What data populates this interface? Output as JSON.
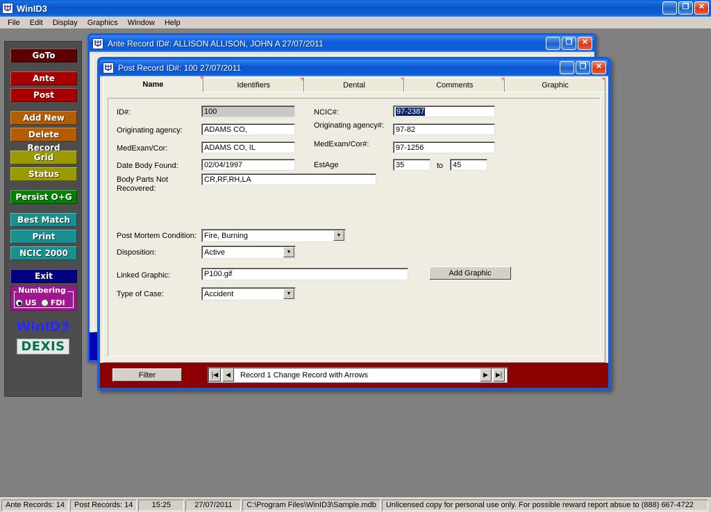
{
  "app": {
    "title": "WinID3",
    "icon": "winid-icon",
    "menus": [
      "File",
      "Edit",
      "Display",
      "Graphics",
      "Window",
      "Help"
    ],
    "window_controls": {
      "minimize": "_",
      "restore": "❐",
      "close": "✕"
    }
  },
  "sidebar": {
    "buttons": [
      {
        "label": "GoTo",
        "color": "#5c0000"
      },
      {
        "label": "Ante",
        "color": "#a80000"
      },
      {
        "label": "Post",
        "color": "#a80000"
      },
      {
        "label": "Add New",
        "color": "#b35c00"
      },
      {
        "label": "Delete Record",
        "color": "#b35c00"
      },
      {
        "label": "Grid",
        "color": "#9a9a00"
      },
      {
        "label": "Status",
        "color": "#9a9a00"
      },
      {
        "label": "Persist O+G",
        "color": "#008000"
      },
      {
        "label": "Best Match",
        "color": "#1a8f8f"
      },
      {
        "label": "Print",
        "color": "#1a8f8f"
      },
      {
        "label": "NCIC 2000",
        "color": "#1a8f8f"
      },
      {
        "label": "Exit",
        "color": "#000080"
      }
    ],
    "numbering": {
      "legend": "Numbering",
      "options": [
        {
          "label": "US",
          "selected": true
        },
        {
          "label": "FDI",
          "selected": false
        }
      ]
    },
    "brand_primary": "WinID3",
    "brand_secondary": "DEXIS"
  },
  "ante_window": {
    "title": "Ante  Record ID#: ALLISON  ALLISON, JOHN A  27/07/2011",
    "icon": "winid-icon",
    "controls": {
      "minimize": "_",
      "maximize": "❐",
      "close": "✕"
    }
  },
  "post_window": {
    "title": "Post  Record ID#: 100  27/07/2011",
    "icon": "winid-icon",
    "controls": {
      "minimize": "_",
      "maximize": "❐",
      "close": "✕"
    },
    "tabs": [
      {
        "label": "Name",
        "active": true
      },
      {
        "label": "Identifiers",
        "active": false
      },
      {
        "label": "Dental",
        "active": false
      },
      {
        "label": "Comments",
        "active": false
      },
      {
        "label": "Graphic",
        "active": false
      }
    ],
    "form": {
      "id_label": "ID#:",
      "id_value": "100",
      "originating_agency_label": "Originating agency:",
      "originating_agency_value": "ADAMS CO,",
      "medexam_cor_label": "MedExam/Cor:",
      "medexam_cor_value": "ADAMS CO, IL",
      "date_body_found_label": "Date Body Found:",
      "date_body_found_value": "02/04/1997",
      "body_parts_label_line1": "Body Parts Not",
      "body_parts_label_line2": "Recovered:",
      "body_parts_value": "CR,RF,RH,LA",
      "ncic_label": "NCIC#:",
      "ncic_value": "97-2387",
      "ncic_selected": true,
      "orig_agency_num_label": "Originating agency#:",
      "orig_agency_num_value": "97-82",
      "medexam_cor_num_label": "MedExam/Cor#:",
      "medexam_cor_num_value": "97-1256",
      "estage_label": "EstAge",
      "estage_from": "35",
      "estage_to_label": "to",
      "estage_to": "45",
      "post_mortem_label": "Post Mortem Condition:",
      "post_mortem_value": "Fire, Burning",
      "disposition_label": "Disposition:",
      "disposition_value": "Active",
      "linked_graphic_label": "Linked Graphic:",
      "linked_graphic_value": "P100.gif",
      "add_graphic_button": "Add Graphic",
      "type_of_case_label": "Type of Case:",
      "type_of_case_value": "Accident"
    },
    "footer": {
      "filter_button": "Filter",
      "nav_first": "|◀",
      "nav_prev": "◀",
      "nav_next": "▶",
      "nav_last": "▶|",
      "record_text": "Record 1   Change Record with Arrows"
    }
  },
  "statusbar": {
    "cells": [
      "Ante Records: 14",
      "Post Records: 14",
      "15:25",
      "27/07/2011",
      "C:\\Program Files\\WinID3\\Sample.mdb",
      "Unlicensed copy for personal use only.  For possible reward report absue to (888) 667-4722"
    ]
  },
  "colors": {
    "titlebar_blue": "#0b55d2",
    "window_border": "#1560d8",
    "footer_red": "#8b0000",
    "form_bg": "#efece1",
    "desktop_gray": "#808080"
  }
}
